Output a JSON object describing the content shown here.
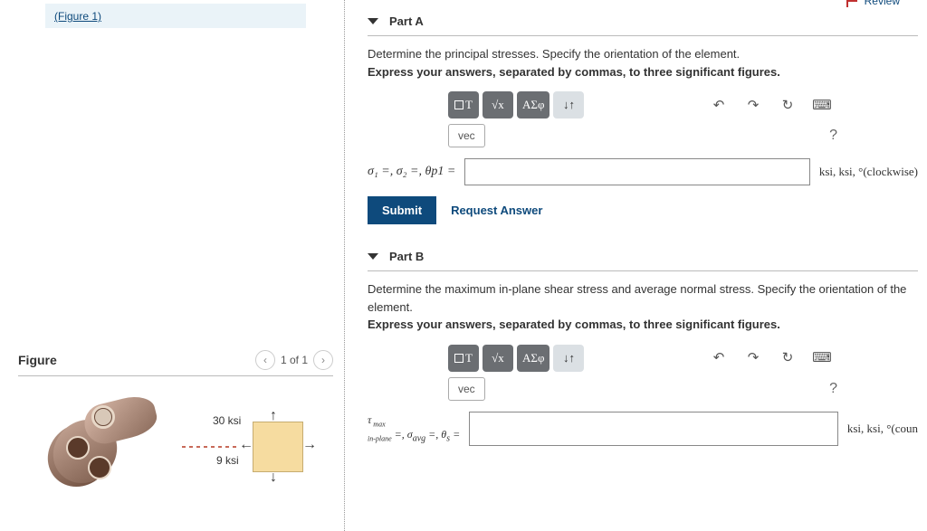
{
  "review_label": "Review",
  "figure_link": "(Figure 1)",
  "figure_panel": {
    "title": "Figure",
    "pager": "1 of 1",
    "labels": {
      "top_stress": "30 ksi",
      "side_stress": "9 ksi"
    }
  },
  "parts": {
    "a": {
      "title": "Part A",
      "instr1": "Determine the principal stresses. Specify the orientation of the element.",
      "instr2": "Express your answers, separated by commas, to three significant figures.",
      "eq_label": "σ₁ =, σ₂ =, θp1 =",
      "units": "ksi, ksi, °(clockwise)",
      "submit": "Submit",
      "request": "Request Answer"
    },
    "b": {
      "title": "Part B",
      "instr1": "Determine the maximum in-plane shear stress and average normal stress. Specify the orientation of the element.",
      "instr2": "Express your answers, separated by commas, to three significant figures.",
      "eq_label": "τ max in-plane =, σavg =, θs =",
      "units": "ksi, ksi, °(coun"
    }
  },
  "toolbar": {
    "template": "T",
    "math": "√x",
    "symbols": "ΑΣφ",
    "arrows": "↓↑",
    "vec_label": "vec",
    "help": "?"
  }
}
